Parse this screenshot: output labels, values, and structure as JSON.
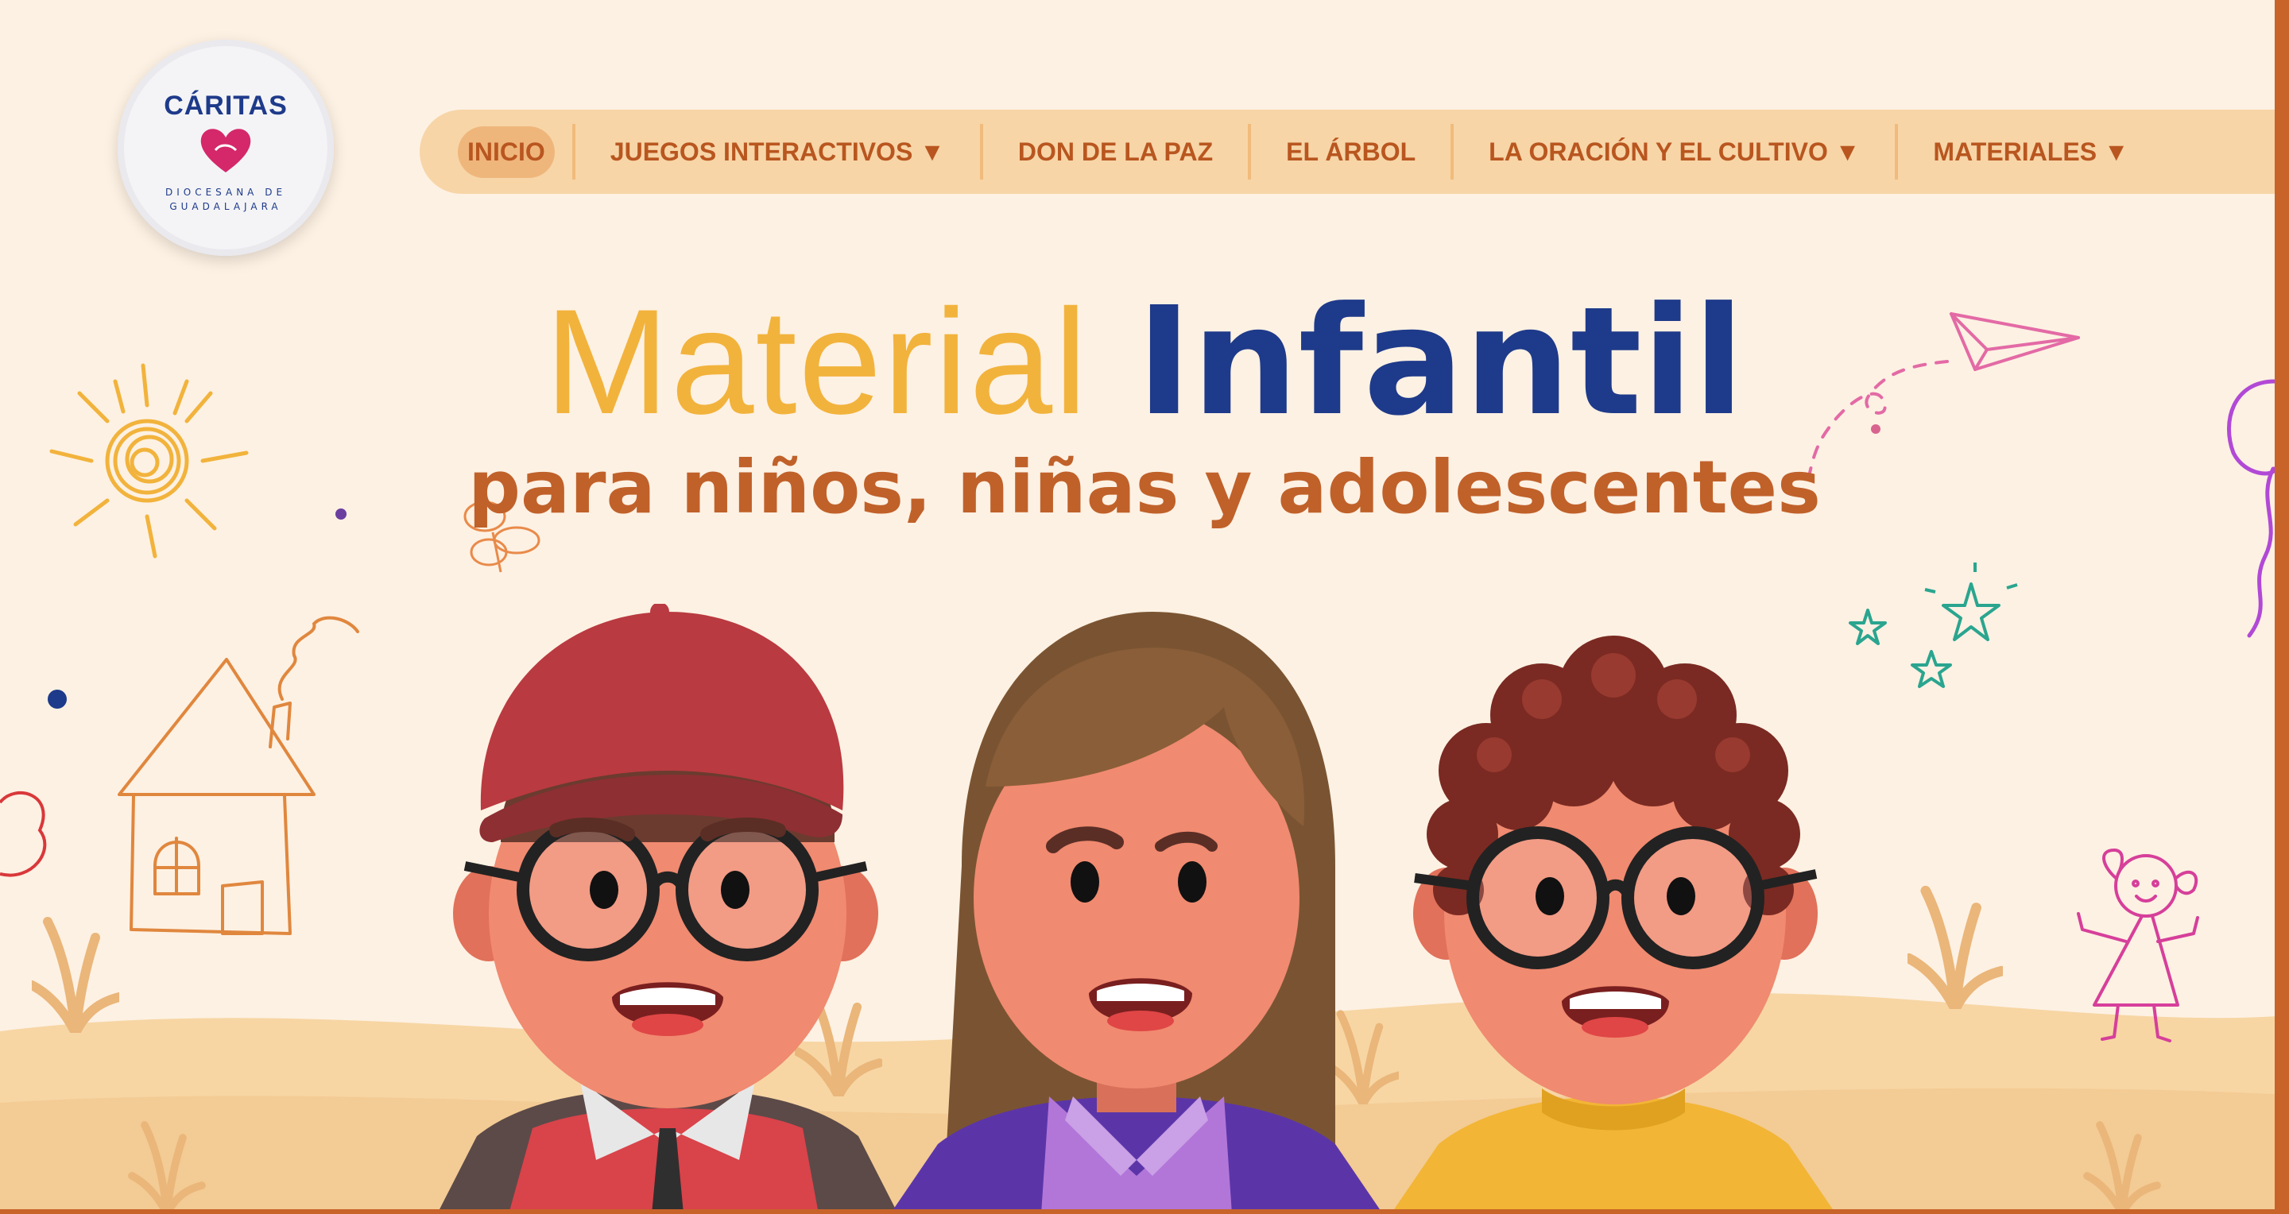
{
  "logo": {
    "title": "CÁRITAS",
    "subtitle": "DIOCESANA DE GUADALAJARA"
  },
  "nav": {
    "items": [
      {
        "label": "INICIO",
        "active": true
      },
      {
        "label": "JUEGOS INTERACTIVOS ▼"
      },
      {
        "label": "DON DE LA PAZ"
      },
      {
        "label": "EL ÁRBOL"
      },
      {
        "label": "LA ORACIÓN Y EL CULTIVO ▼"
      },
      {
        "label": "MATERIALES ▼"
      }
    ]
  },
  "hero": {
    "title_light": "Material",
    "title_bold": "Infantil",
    "subtitle": "para niños, niñas y adolescentes"
  },
  "colors": {
    "background": "#fdf1e3",
    "nav_bg": "#f7d5a7",
    "nav_text": "#b9561f",
    "accent_yellow": "#f2b33c",
    "accent_blue": "#1e3a8a",
    "accent_orange": "#c0612a"
  },
  "icons": [
    "sun-icon",
    "house-icon",
    "heart-icon",
    "paper-plane-icon",
    "stars-icon",
    "girl-doodle-icon",
    "balloon-icon",
    "flower-icon"
  ]
}
